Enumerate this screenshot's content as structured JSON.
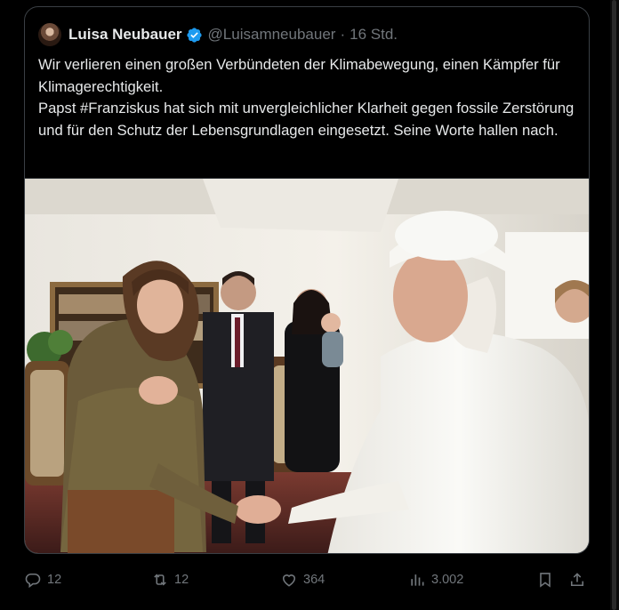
{
  "author": {
    "display_name": "Luisa Neubauer",
    "handle": "@Luisamneubauer",
    "separator": "·",
    "time": "16 Std.",
    "verified": true,
    "verified_color": "#1d9bf0"
  },
  "tweet": {
    "line1": "Wir verlieren einen großen Verbündeten der Klimabewegung, einen Kämpfer für Klimagerechtigkeit.",
    "line2_prefix": "Papst ",
    "hashtag": "#Franziskus",
    "line2_rest": " hat sich mit unvergleichlicher Klarheit gegen fossile Zerstörung und für den Schutz der Lebensgrundlagen eingesetzt. Seine Worte hallen nach."
  },
  "actions": {
    "replies": "12",
    "reposts": "12",
    "likes": "364",
    "views": "3.002",
    "reply_icon": "reply-icon",
    "repost_icon": "repost-icon",
    "like_icon": "heart-icon",
    "views_icon": "analytics-icon",
    "bookmark_icon": "bookmark-icon",
    "share_icon": "share-icon"
  },
  "colors": {
    "background": "#000000",
    "text": "#e7e9ea",
    "muted": "#71767b",
    "border": "#3a3f44"
  }
}
